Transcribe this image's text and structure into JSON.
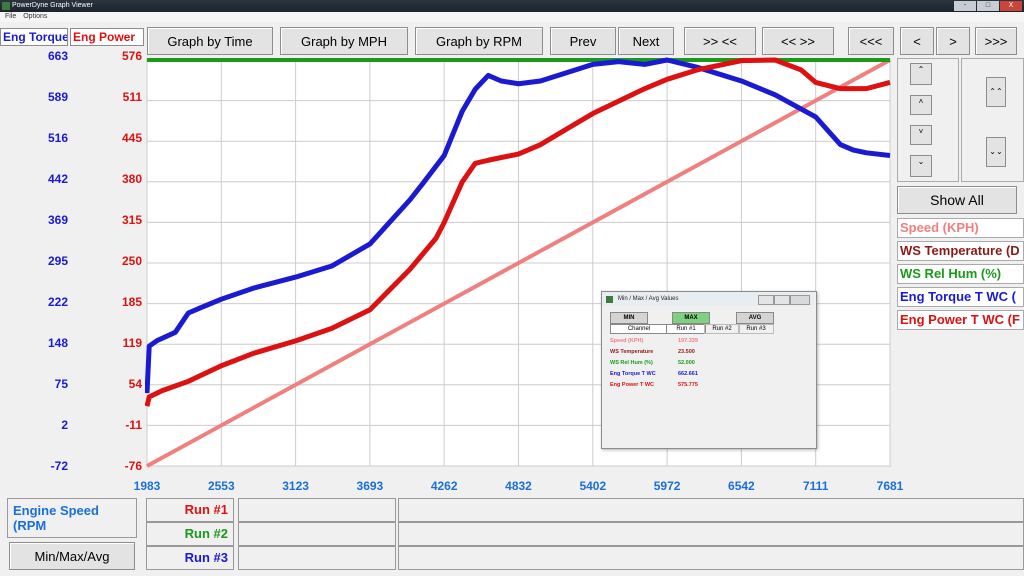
{
  "window": {
    "title": "PowerDyne Graph Viewer",
    "menu": [
      "File",
      "Options"
    ],
    "buttons": [
      "-",
      "□",
      "X"
    ]
  },
  "toolbar": {
    "graph_time": "Graph by Time",
    "graph_mph": "Graph by MPH",
    "graph_rpm": "Graph by RPM",
    "prev": "Prev",
    "next": "Next",
    "zoom_in": ">> <<",
    "zoom_out": "<< >>",
    "scroll_left": "<<<",
    "left": "<",
    "right": ">",
    "scroll_right": ">>>"
  },
  "axes": {
    "left_label": "Eng Torque",
    "left2_label": "Eng Power",
    "torque_ticks": [
      "663",
      "589",
      "516",
      "442",
      "369",
      "295",
      "222",
      "148",
      "75",
      "2",
      "-72"
    ],
    "power_ticks": [
      "576",
      "511",
      "445",
      "380",
      "315",
      "250",
      "185",
      "119",
      "54",
      "-11",
      "-76"
    ],
    "x_ticks": [
      "1983",
      "2553",
      "3123",
      "3693",
      "4262",
      "4832",
      "5402",
      "5972",
      "6542",
      "7111",
      "7681"
    ]
  },
  "side": {
    "show_all": "Show All",
    "legend": [
      {
        "label": "Speed (KPH)",
        "color": "#f08080"
      },
      {
        "label": "WS Temperature (D",
        "color": "#8b1a1a"
      },
      {
        "label": "WS Rel Hum (%)",
        "color": "#1a9a1a"
      },
      {
        "label": "Eng Torque T WC (",
        "color": "#1a1ad2"
      },
      {
        "label": "Eng Power T WC (F",
        "color": "#dd1111"
      }
    ]
  },
  "bottom": {
    "xaxis_label": "Engine Speed (RPM",
    "runs": [
      {
        "label": "Run #1",
        "color": "#dd1111"
      },
      {
        "label": "Run #2",
        "color": "#1a9a1a"
      },
      {
        "label": "Run #3",
        "color": "#1a1ad2"
      }
    ],
    "minmax_btn": "Min/Max/Avg"
  },
  "minmax": {
    "title": "Min / Max / Avg Values",
    "buttons": [
      "MIN",
      "MAX",
      "AVG"
    ],
    "columns": [
      "Channel",
      "Run #1",
      "Run #2",
      "Run #3"
    ],
    "rows": [
      {
        "name": "Speed (KPH)",
        "value": "197.339",
        "color": "#f08080"
      },
      {
        "name": "WS Temperature",
        "value": "23.500",
        "color": "#8b1a1a"
      },
      {
        "name": "WS Rel Hum (%)",
        "value": "52.000",
        "color": "#1a9a1a"
      },
      {
        "name": "Eng Torque T WC",
        "value": "662.661",
        "color": "#1a1ad2"
      },
      {
        "name": "Eng Power T WC",
        "value": "575.775",
        "color": "#dd1111"
      }
    ]
  },
  "chart_data": {
    "type": "line",
    "xlabel": "Engine Speed (RPM",
    "xlim": [
      1983,
      7681
    ],
    "torque_ylim": [
      -72,
      663
    ],
    "power_ylim": [
      -76,
      576
    ],
    "series": [
      {
        "name": "Eng Torque T WC",
        "color": "#1a1ad2",
        "axis": "torque",
        "x": [
          1983,
          2000,
          2060,
          2200,
          2300,
          2400,
          2553,
          2800,
          3123,
          3400,
          3693,
          4000,
          4100,
          4262,
          4400,
          4500,
          4600,
          4700,
          4832,
          5000,
          5200,
          5402,
          5600,
          5800,
          5972,
          6200,
          6542,
          6800,
          7111,
          7300,
          7400,
          7500,
          7681
        ],
        "y": [
          60,
          145,
          155,
          170,
          205,
          215,
          230,
          250,
          270,
          290,
          330,
          410,
          440,
          490,
          570,
          610,
          635,
          625,
          620,
          625,
          640,
          655,
          660,
          655,
          663,
          650,
          625,
          600,
          560,
          510,
          500,
          495,
          490
        ]
      },
      {
        "name": "Eng Power T WC",
        "color": "#dd1111",
        "axis": "power",
        "x": [
          1983,
          2000,
          2100,
          2300,
          2553,
          2800,
          3123,
          3400,
          3693,
          4000,
          4200,
          4262,
          4400,
          4500,
          4600,
          4832,
          5000,
          5200,
          5402,
          5600,
          5800,
          5972,
          6200,
          6542,
          6800,
          7000,
          7111,
          7300,
          7500,
          7681
        ],
        "y": [
          20,
          35,
          45,
          60,
          85,
          105,
          125,
          145,
          175,
          240,
          290,
          315,
          380,
          410,
          415,
          425,
          440,
          465,
          490,
          510,
          530,
          545,
          560,
          575,
          576,
          560,
          540,
          530,
          530,
          540
        ]
      },
      {
        "name": "Speed (KPH)",
        "color": "#f08080",
        "axis": "power",
        "x": [
          1983,
          7681
        ],
        "y": [
          -76,
          576
        ]
      },
      {
        "name": "WS Rel Hum (%)",
        "color": "#1a9a1a",
        "axis": "power",
        "x": [
          1983,
          7681
        ],
        "y": [
          576,
          576
        ]
      }
    ]
  }
}
